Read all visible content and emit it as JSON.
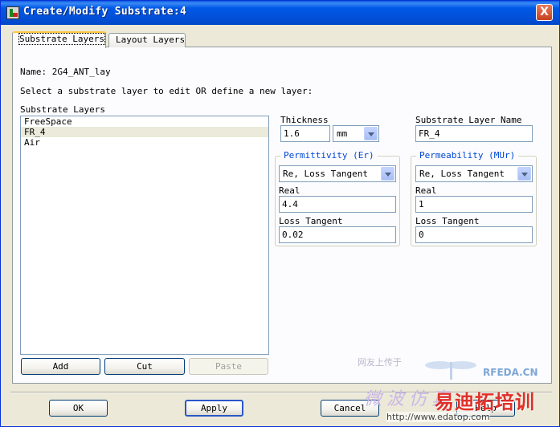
{
  "window": {
    "title": "Create/Modify Substrate:4",
    "close_label": "X"
  },
  "tabs": [
    {
      "label": "Substrate Layers",
      "active": true
    },
    {
      "label": "Layout Layers",
      "active": false
    }
  ],
  "name_line": "Name: 2G4_ANT_lay",
  "instruction": "Select a substrate layer to edit OR define a new layer:",
  "layers": {
    "heading": "Substrate Layers",
    "items": [
      "FreeSpace",
      "FR_4",
      "Air"
    ],
    "selected_index": 1,
    "buttons": {
      "add": "Add",
      "cut": "Cut",
      "paste": "Paste"
    }
  },
  "thickness": {
    "label": "Thickness",
    "value": "1.6",
    "unit": "mm"
  },
  "layer_name": {
    "label": "Substrate Layer Name",
    "value": "FR_4"
  },
  "permittivity": {
    "legend": "Permittivity (Er)",
    "mode": "Re, Loss Tangent",
    "real_label": "Real",
    "real_value": "4.4",
    "loss_label": "Loss Tangent",
    "loss_value": "0.02"
  },
  "permeability": {
    "legend": "Permeability (MUr)",
    "mode": "Re, Loss Tangent",
    "real_label": "Real",
    "real_value": "1",
    "loss_label": "Loss Tangent",
    "loss_value": "0"
  },
  "footer": {
    "ok": "OK",
    "apply": "Apply",
    "cancel": "Cancel",
    "help": "Help"
  },
  "watermark": {
    "top_text": "网友上传于",
    "brand": "RFEDA.CN",
    "italic_text": "微波仿真",
    "red_text": "易迪拓培训",
    "url": "http://www.edatop.com"
  }
}
